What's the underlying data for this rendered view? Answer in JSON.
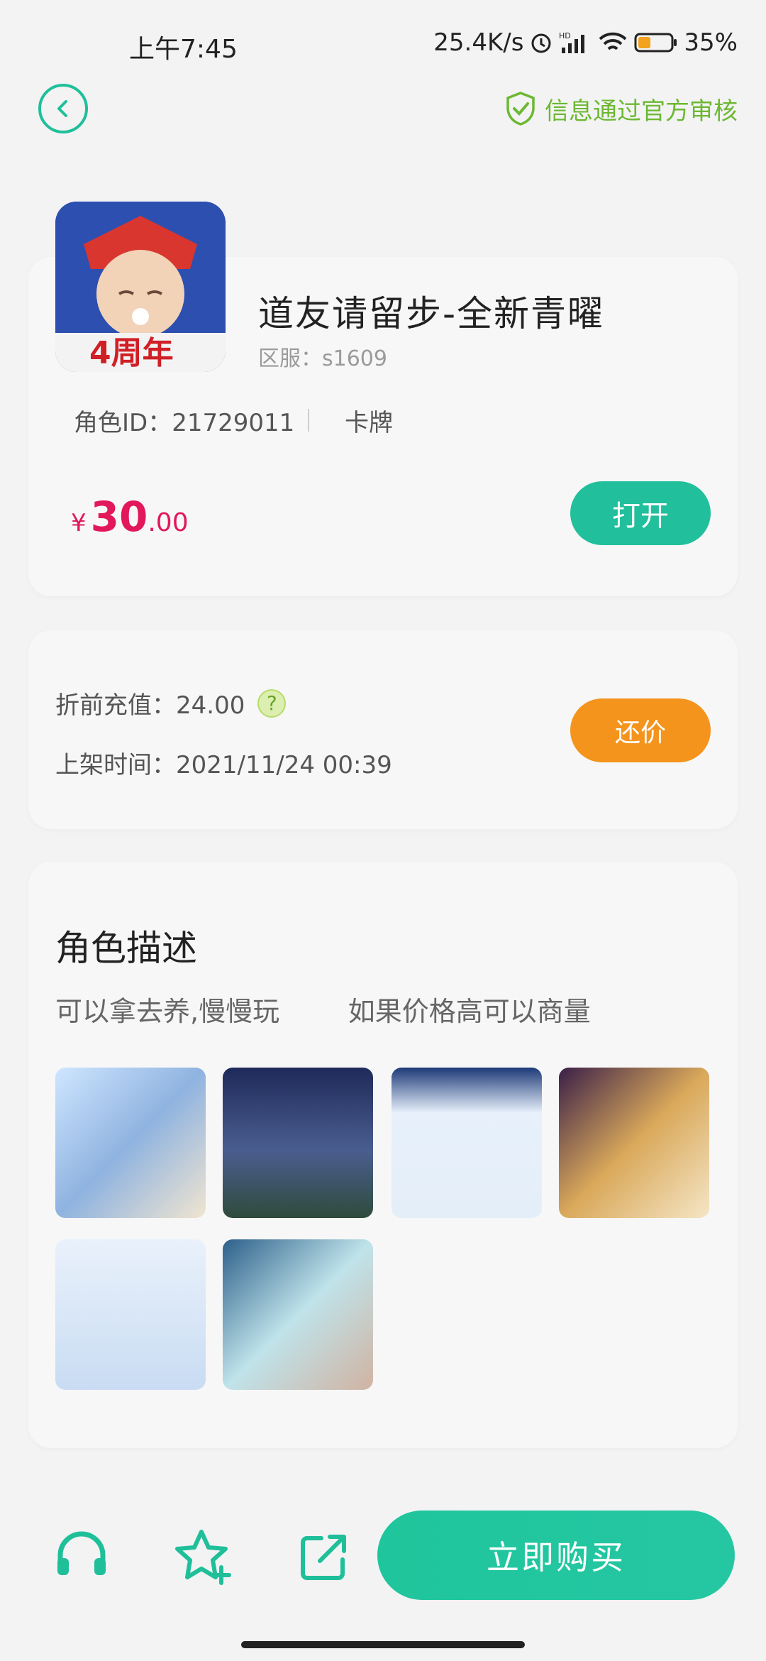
{
  "status_bar": {
    "time": "上午7:45",
    "speed": "25.4K/s",
    "battery": "35%",
    "icons": [
      "alarm-icon",
      "hd-signal-icon",
      "wifi-icon",
      "battery-icon"
    ]
  },
  "header": {
    "back_icon": "back-chevron-icon",
    "verified_text": "信息通过官方审核",
    "verified_icon": "shield-check-icon"
  },
  "product": {
    "game_title": "道友请留步-全新青曜",
    "server": "区服：s1609",
    "role_id": "角色ID：21729011",
    "role_type": "卡牌",
    "price": {
      "currency": "¥",
      "integer": "30",
      "decimal": ".00"
    },
    "open_label": "打开",
    "icon_badge_text": "4周年"
  },
  "details": {
    "recharge": "折前充值：24.00",
    "help_icon": "?",
    "listed_time": "上架时间：2021/11/24 00:39",
    "bargain_label": "还价"
  },
  "description": {
    "title": "角色描述",
    "text": "可以拿去养,慢慢玩        如果价格高可以商量",
    "screenshots_count": 6
  },
  "bottom_bar": {
    "buy_label": "立即购买",
    "icons": [
      "customer-service-icon",
      "favorite-add-icon",
      "share-icon"
    ]
  },
  "colors": {
    "accent": "#22bf9c",
    "price": "#e2185b",
    "bargain": "#f4941c",
    "verified": "#6cb832"
  }
}
